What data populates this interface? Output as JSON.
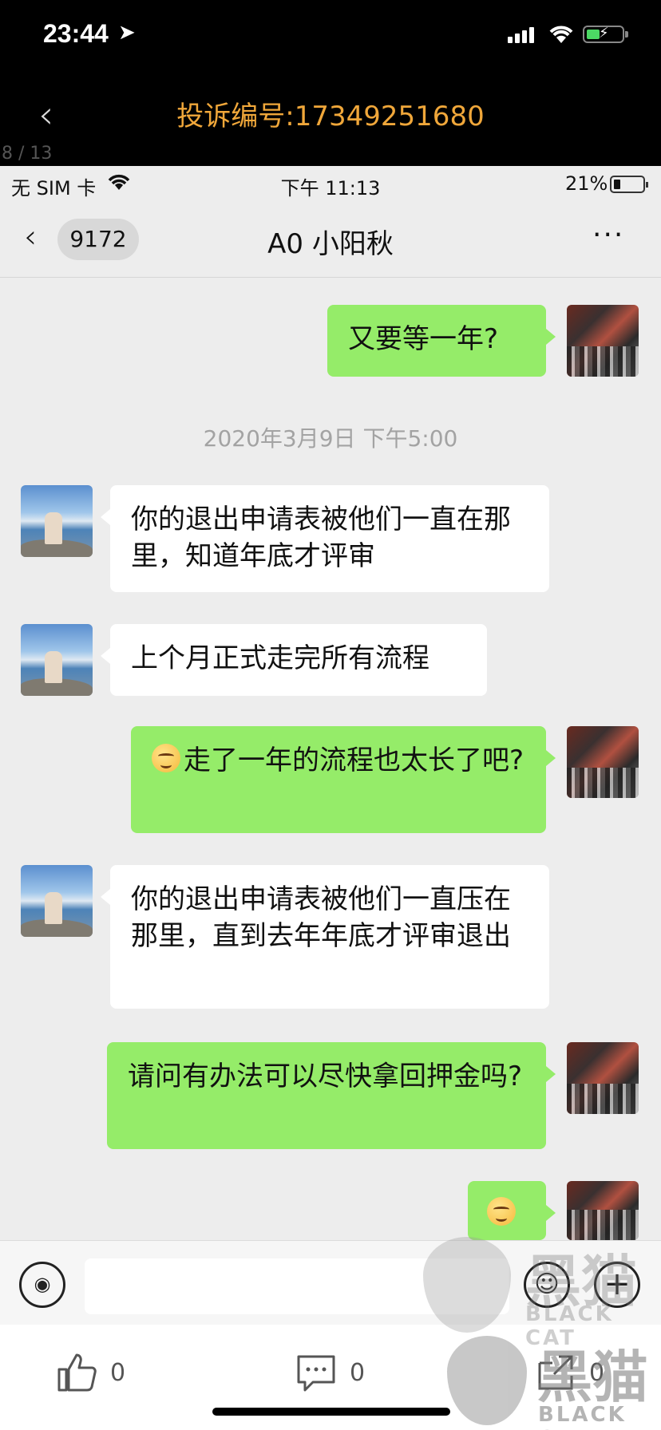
{
  "outer_status": {
    "time": "23:44"
  },
  "outer_header": {
    "title": "投诉编号:17349251680",
    "page_counter": "8 / 13"
  },
  "inner_status": {
    "carrier": "无 SIM 卡",
    "time": "下午 11:13",
    "battery": "21%"
  },
  "chat_header": {
    "unread_count": "9172",
    "contact_name": "A0 小阳秋"
  },
  "timestamp": "2020年3月9日 下午5:00",
  "messages": [
    {
      "from": "me",
      "text": "又要等一年?"
    },
    {
      "from": "other",
      "text": "你的退出申请表被他们一直在那里，知道年底才评审"
    },
    {
      "from": "other",
      "text": "上个月正式走完所有流程"
    },
    {
      "from": "me",
      "text": "走了一年的流程也太长了吧?"
    },
    {
      "from": "other",
      "text": "你的退出申请表被他们一直压在那里，直到去年年底才评审退出"
    },
    {
      "from": "me",
      "text": "请问有办法可以尽快拿回押金吗?"
    },
    {
      "from": "me",
      "text": ""
    }
  ],
  "toolbar": {
    "like_count": "0",
    "comment_count": "0",
    "share_count": "0"
  },
  "watermark": {
    "brand_cn": "黑猫",
    "brand_en": "BLACK CAT"
  }
}
